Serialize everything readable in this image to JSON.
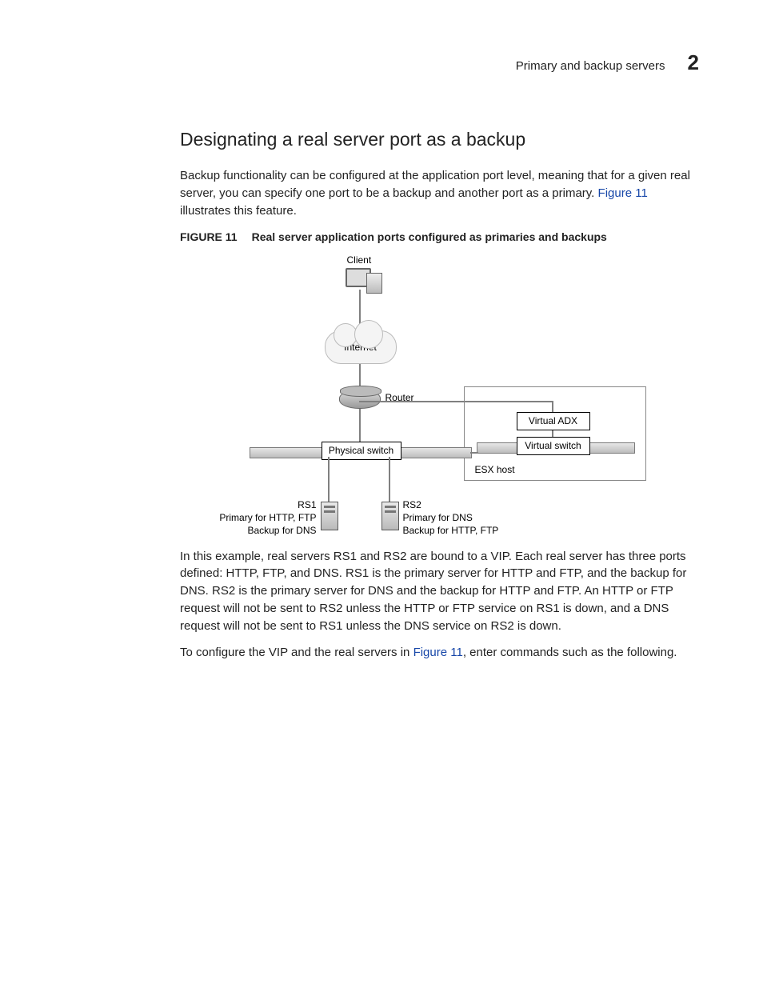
{
  "header": {
    "title": "Primary and backup servers",
    "chapter": "2"
  },
  "section": {
    "heading": "Designating a real server port as a backup"
  },
  "intro": {
    "t1": "Backup functionality can be configured at the application port level, meaning that for a given real server, you can specify one port to be a backup and another port as a primary. ",
    "link": "Figure 11",
    "t2": " illustrates this feature."
  },
  "figure": {
    "label": "FIGURE 11",
    "caption": "Real server application ports configured as primaries and backups",
    "nodes": {
      "client": "Client",
      "internet": "Internet",
      "router": "Router",
      "physical_switch": "Physical switch",
      "virtual_adx": "Virtual ADX",
      "virtual_switch": "Virtual switch",
      "esx_host": "ESX host",
      "rs1": {
        "name": "RS1",
        "role_primary": "Primary for HTTP, FTP",
        "role_backup": "Backup for DNS"
      },
      "rs2": {
        "name": "RS2",
        "role_primary": "Primary for DNS",
        "role_backup": "Backup for HTTP, FTP"
      }
    }
  },
  "para2": "In this example, real servers RS1 and RS2 are bound to a VIP. Each real server has three ports defined: HTTP, FTP, and DNS. RS1 is the primary server for HTTP and FTP, and the backup for DNS. RS2 is the primary server for DNS and the backup for HTTP and FTP. An HTTP or FTP request will not be sent to RS2 unless the HTTP or FTP service on RS1 is down, and a DNS request will not be sent to RS1 unless the DNS service on RS2 is down.",
  "para3": {
    "t1": "To configure the VIP and the real servers in ",
    "link": "Figure 11",
    "t2": ", enter commands such as the following."
  }
}
